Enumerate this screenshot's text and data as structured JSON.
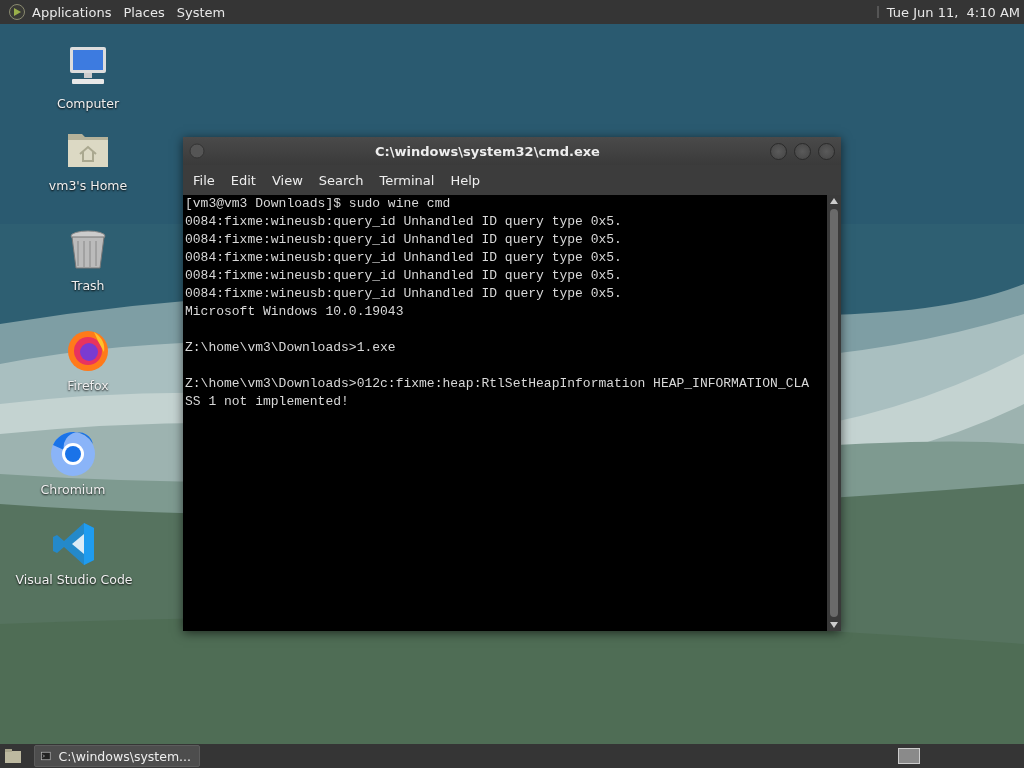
{
  "top_panel": {
    "menus": [
      "Applications",
      "Places",
      "System"
    ],
    "clock": "Tue Jun 11,  4:10 AM"
  },
  "desktop": {
    "icons": [
      {
        "label": "Computer",
        "kind": "computer"
      },
      {
        "label": "vm3's Home",
        "kind": "home"
      },
      {
        "label": "Trash",
        "kind": "trash"
      },
      {
        "label": "Firefox",
        "kind": "firefox"
      },
      {
        "label": "Chromium",
        "kind": "chromium"
      },
      {
        "label": "Visual Studio Code",
        "kind": "vscode"
      }
    ]
  },
  "window": {
    "title": "C:\\windows\\system32\\cmd.exe",
    "menu": [
      "File",
      "Edit",
      "View",
      "Search",
      "Terminal",
      "Help"
    ],
    "output_blocks": [
      [
        "[vm3@vm3 Downloads]$ sudo wine cmd",
        "0084:fixme:wineusb:query_id Unhandled ID query type 0x5.",
        "0084:fixme:wineusb:query_id Unhandled ID query type 0x5.",
        "0084:fixme:wineusb:query_id Unhandled ID query type 0x5.",
        "0084:fixme:wineusb:query_id Unhandled ID query type 0x5.",
        "0084:fixme:wineusb:query_id Unhandled ID query type 0x5.",
        "Microsoft Windows 10.0.19043"
      ],
      [
        "Z:\\home\\vm3\\Downloads>1.exe"
      ],
      [
        "Z:\\home\\vm3\\Downloads>012c:fixme:heap:RtlSetHeapInformation HEAP_INFORMATION_CLA",
        "SS 1 not implemented!"
      ]
    ]
  },
  "taskbar": {
    "tasks": [
      {
        "label": "C:\\windows\\system...",
        "selected": true
      }
    ]
  }
}
